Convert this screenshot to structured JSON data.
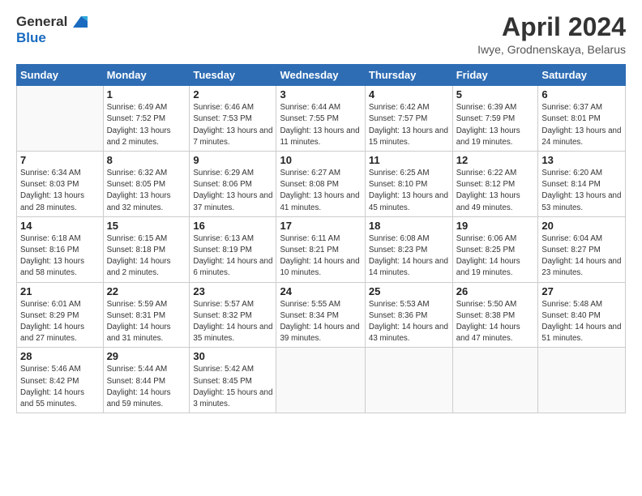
{
  "logo": {
    "text1": "General",
    "text2": "Blue"
  },
  "title": "April 2024",
  "subtitle": "Iwye, Grodnenskaya, Belarus",
  "columns": [
    "Sunday",
    "Monday",
    "Tuesday",
    "Wednesday",
    "Thursday",
    "Friday",
    "Saturday"
  ],
  "weeks": [
    [
      {
        "day": "",
        "sunrise": "",
        "sunset": "",
        "daylight": ""
      },
      {
        "day": "1",
        "sunrise": "Sunrise: 6:49 AM",
        "sunset": "Sunset: 7:52 PM",
        "daylight": "Daylight: 13 hours and 2 minutes."
      },
      {
        "day": "2",
        "sunrise": "Sunrise: 6:46 AM",
        "sunset": "Sunset: 7:53 PM",
        "daylight": "Daylight: 13 hours and 7 minutes."
      },
      {
        "day": "3",
        "sunrise": "Sunrise: 6:44 AM",
        "sunset": "Sunset: 7:55 PM",
        "daylight": "Daylight: 13 hours and 11 minutes."
      },
      {
        "day": "4",
        "sunrise": "Sunrise: 6:42 AM",
        "sunset": "Sunset: 7:57 PM",
        "daylight": "Daylight: 13 hours and 15 minutes."
      },
      {
        "day": "5",
        "sunrise": "Sunrise: 6:39 AM",
        "sunset": "Sunset: 7:59 PM",
        "daylight": "Daylight: 13 hours and 19 minutes."
      },
      {
        "day": "6",
        "sunrise": "Sunrise: 6:37 AM",
        "sunset": "Sunset: 8:01 PM",
        "daylight": "Daylight: 13 hours and 24 minutes."
      }
    ],
    [
      {
        "day": "7",
        "sunrise": "Sunrise: 6:34 AM",
        "sunset": "Sunset: 8:03 PM",
        "daylight": "Daylight: 13 hours and 28 minutes."
      },
      {
        "day": "8",
        "sunrise": "Sunrise: 6:32 AM",
        "sunset": "Sunset: 8:05 PM",
        "daylight": "Daylight: 13 hours and 32 minutes."
      },
      {
        "day": "9",
        "sunrise": "Sunrise: 6:29 AM",
        "sunset": "Sunset: 8:06 PM",
        "daylight": "Daylight: 13 hours and 37 minutes."
      },
      {
        "day": "10",
        "sunrise": "Sunrise: 6:27 AM",
        "sunset": "Sunset: 8:08 PM",
        "daylight": "Daylight: 13 hours and 41 minutes."
      },
      {
        "day": "11",
        "sunrise": "Sunrise: 6:25 AM",
        "sunset": "Sunset: 8:10 PM",
        "daylight": "Daylight: 13 hours and 45 minutes."
      },
      {
        "day": "12",
        "sunrise": "Sunrise: 6:22 AM",
        "sunset": "Sunset: 8:12 PM",
        "daylight": "Daylight: 13 hours and 49 minutes."
      },
      {
        "day": "13",
        "sunrise": "Sunrise: 6:20 AM",
        "sunset": "Sunset: 8:14 PM",
        "daylight": "Daylight: 13 hours and 53 minutes."
      }
    ],
    [
      {
        "day": "14",
        "sunrise": "Sunrise: 6:18 AM",
        "sunset": "Sunset: 8:16 PM",
        "daylight": "Daylight: 13 hours and 58 minutes."
      },
      {
        "day": "15",
        "sunrise": "Sunrise: 6:15 AM",
        "sunset": "Sunset: 8:18 PM",
        "daylight": "Daylight: 14 hours and 2 minutes."
      },
      {
        "day": "16",
        "sunrise": "Sunrise: 6:13 AM",
        "sunset": "Sunset: 8:19 PM",
        "daylight": "Daylight: 14 hours and 6 minutes."
      },
      {
        "day": "17",
        "sunrise": "Sunrise: 6:11 AM",
        "sunset": "Sunset: 8:21 PM",
        "daylight": "Daylight: 14 hours and 10 minutes."
      },
      {
        "day": "18",
        "sunrise": "Sunrise: 6:08 AM",
        "sunset": "Sunset: 8:23 PM",
        "daylight": "Daylight: 14 hours and 14 minutes."
      },
      {
        "day": "19",
        "sunrise": "Sunrise: 6:06 AM",
        "sunset": "Sunset: 8:25 PM",
        "daylight": "Daylight: 14 hours and 19 minutes."
      },
      {
        "day": "20",
        "sunrise": "Sunrise: 6:04 AM",
        "sunset": "Sunset: 8:27 PM",
        "daylight": "Daylight: 14 hours and 23 minutes."
      }
    ],
    [
      {
        "day": "21",
        "sunrise": "Sunrise: 6:01 AM",
        "sunset": "Sunset: 8:29 PM",
        "daylight": "Daylight: 14 hours and 27 minutes."
      },
      {
        "day": "22",
        "sunrise": "Sunrise: 5:59 AM",
        "sunset": "Sunset: 8:31 PM",
        "daylight": "Daylight: 14 hours and 31 minutes."
      },
      {
        "day": "23",
        "sunrise": "Sunrise: 5:57 AM",
        "sunset": "Sunset: 8:32 PM",
        "daylight": "Daylight: 14 hours and 35 minutes."
      },
      {
        "day": "24",
        "sunrise": "Sunrise: 5:55 AM",
        "sunset": "Sunset: 8:34 PM",
        "daylight": "Daylight: 14 hours and 39 minutes."
      },
      {
        "day": "25",
        "sunrise": "Sunrise: 5:53 AM",
        "sunset": "Sunset: 8:36 PM",
        "daylight": "Daylight: 14 hours and 43 minutes."
      },
      {
        "day": "26",
        "sunrise": "Sunrise: 5:50 AM",
        "sunset": "Sunset: 8:38 PM",
        "daylight": "Daylight: 14 hours and 47 minutes."
      },
      {
        "day": "27",
        "sunrise": "Sunrise: 5:48 AM",
        "sunset": "Sunset: 8:40 PM",
        "daylight": "Daylight: 14 hours and 51 minutes."
      }
    ],
    [
      {
        "day": "28",
        "sunrise": "Sunrise: 5:46 AM",
        "sunset": "Sunset: 8:42 PM",
        "daylight": "Daylight: 14 hours and 55 minutes."
      },
      {
        "day": "29",
        "sunrise": "Sunrise: 5:44 AM",
        "sunset": "Sunset: 8:44 PM",
        "daylight": "Daylight: 14 hours and 59 minutes."
      },
      {
        "day": "30",
        "sunrise": "Sunrise: 5:42 AM",
        "sunset": "Sunset: 8:45 PM",
        "daylight": "Daylight: 15 hours and 3 minutes."
      },
      {
        "day": "",
        "sunrise": "",
        "sunset": "",
        "daylight": ""
      },
      {
        "day": "",
        "sunrise": "",
        "sunset": "",
        "daylight": ""
      },
      {
        "day": "",
        "sunrise": "",
        "sunset": "",
        "daylight": ""
      },
      {
        "day": "",
        "sunrise": "",
        "sunset": "",
        "daylight": ""
      }
    ]
  ]
}
